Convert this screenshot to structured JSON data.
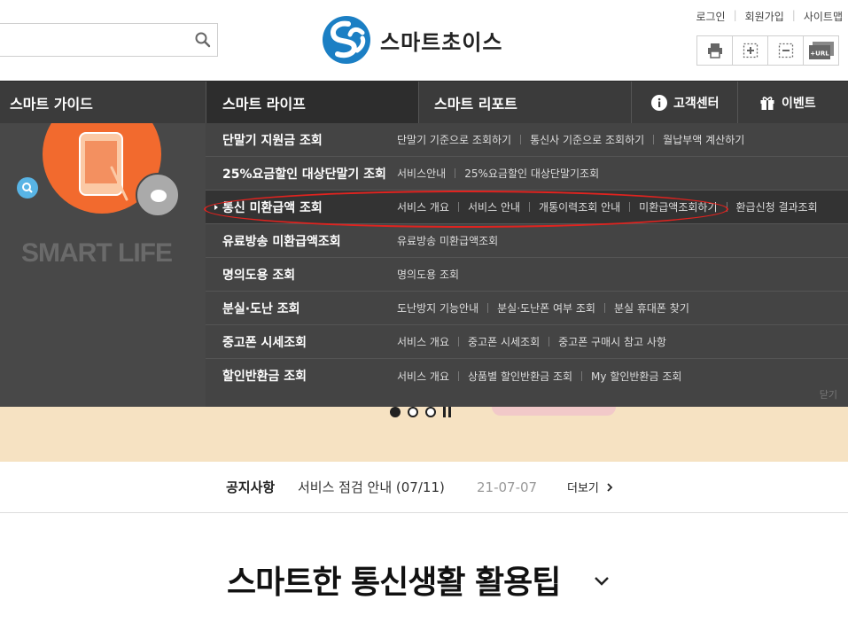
{
  "header": {
    "search_placeholder": "",
    "logo_text": "스마트초이스",
    "util_links": [
      "로그인",
      "회원가입",
      "사이트맵"
    ],
    "tools": [
      {
        "icon": "print-icon"
      },
      {
        "icon": "zoom-in-icon"
      },
      {
        "icon": "zoom-out-icon"
      },
      {
        "icon": "url-copy-icon",
        "label": "+URL"
      }
    ]
  },
  "gnb": {
    "guide": "스마트 가이드",
    "life": "스마트 라이프",
    "report": "스마트 리포트",
    "customer": "고객센터",
    "event": "이벤트"
  },
  "dropdown": {
    "left_caption": "SMART LIFE",
    "close_label": "닫기",
    "rows": [
      {
        "title": "단말기 지원금 조회",
        "links": [
          "단말기 기준으로 조회하기",
          "통신사 기준으로 조회하기",
          "월납부액 계산하기"
        ]
      },
      {
        "title": "25%요금할인 대상단말기 조회",
        "links": [
          "서비스안내",
          "25%요금할인 대상단말기조회"
        ]
      },
      {
        "title": "통신 미환급액 조회",
        "links": [
          "서비스 개요",
          "서비스 안내",
          "개통이력조회 안내",
          "미환급액조회하기",
          "환급신청 결과조회"
        ]
      },
      {
        "title": "유료방송 미환급액조회",
        "links": [
          "유료방송 미환급액조회"
        ]
      },
      {
        "title": "명의도용 조회",
        "links": [
          "명의도용 조회"
        ]
      },
      {
        "title": "분실·도난 조회",
        "links": [
          "도난방지 기능안내",
          "분실·도난폰 여부 조회",
          "분실 휴대폰 찾기"
        ]
      },
      {
        "title": "중고폰 시세조회",
        "links": [
          "서비스 개요",
          "중고폰 시세조회",
          "중고폰 구매시 참고 사항"
        ]
      },
      {
        "title": "할인반환금 조회",
        "links": [
          "서비스 개요",
          "상품별 할인반환금 조회",
          "My 할인반환금 조회"
        ]
      }
    ]
  },
  "notice": {
    "label": "공지사항",
    "title": "서비스 점검 안내 (07/11)",
    "date": "21-07-07",
    "more": "더보기"
  },
  "section": {
    "title": "스마트한 통신생활 활용팁"
  },
  "colors": {
    "gnb_bg": "#3b3b3b",
    "logo_blue": "#1b7fc4",
    "highlight_red": "#e0231f",
    "orange": "#f26a2e",
    "banner": "#f6e2c2"
  }
}
